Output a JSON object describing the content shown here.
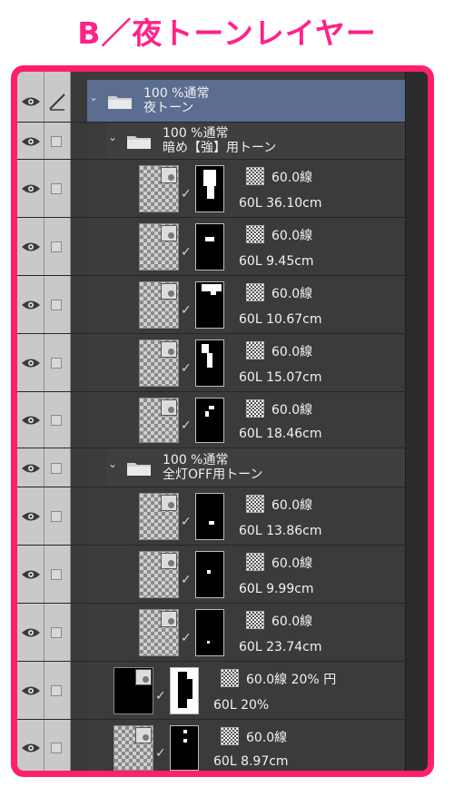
{
  "title": "B／夜トーンレイヤー",
  "colors": {
    "accent": "#ff1f6b",
    "selected_row": "#5b6e91"
  },
  "layers": [
    {
      "kind": "folder",
      "selected": true,
      "has_pen": true,
      "line1": "100 %通常",
      "line2": "夜トーン"
    },
    {
      "kind": "folder",
      "line1": "100 %通常",
      "line2": "暗め【強】用トーン"
    },
    {
      "kind": "layer",
      "tone": "60.0線",
      "info": "60L 36.10cm"
    },
    {
      "kind": "layer",
      "tone": "60.0線",
      "info": "60L 9.45cm"
    },
    {
      "kind": "layer",
      "tone": "60.0線",
      "info": "60L 10.67cm"
    },
    {
      "kind": "layer",
      "tone": "60.0線",
      "info": "60L 15.07cm"
    },
    {
      "kind": "layer",
      "tone": "60.0線",
      "info": "60L 18.46cm"
    },
    {
      "kind": "folder",
      "line1": "100 %通常",
      "line2": "全灯OFF用トーン"
    },
    {
      "kind": "layer",
      "tone": "60.0線",
      "info": "60L 13.86cm"
    },
    {
      "kind": "layer",
      "tone": "60.0線",
      "info": "60L 9.99cm"
    },
    {
      "kind": "layer",
      "tone": "60.0線",
      "info": "60L 23.74cm"
    },
    {
      "kind": "layer",
      "tone": "60.0線 20% 円",
      "info": "60L 20%"
    },
    {
      "kind": "layer",
      "tone": "60.0線",
      "info": "60L 8.97cm"
    }
  ],
  "icons": {
    "visibility": "eye-icon",
    "edit": "pen-icon",
    "folder": "folder-icon",
    "expand": "chevron-down-icon",
    "tone": "tone-pattern-icon",
    "mask_link": "check-icon"
  }
}
